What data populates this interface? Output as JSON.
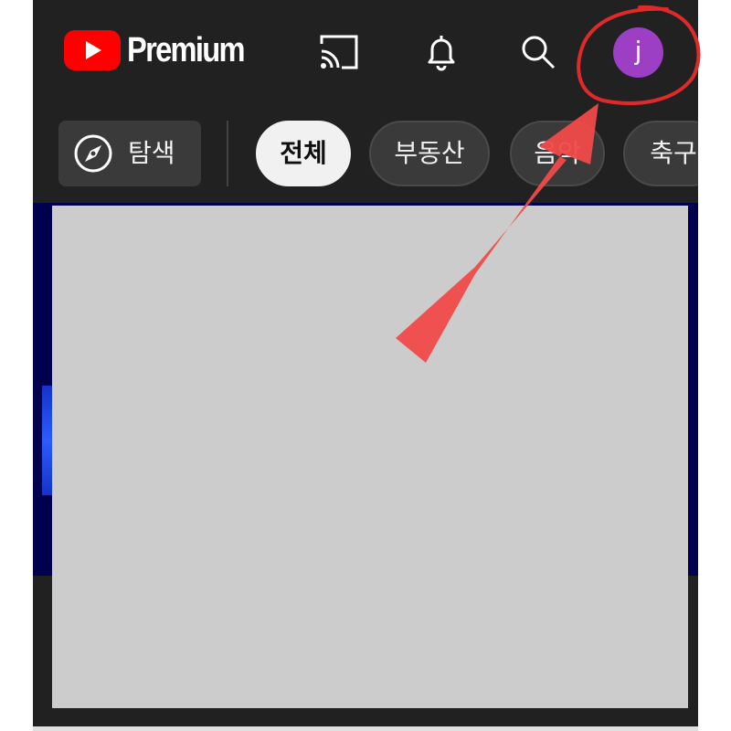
{
  "header": {
    "logo_text": "Premium",
    "avatar_initial": "j"
  },
  "icons": {
    "logo": "youtube-play-icon",
    "cast": "cast-icon",
    "notifications": "bell-icon",
    "search": "search-icon",
    "explore": "compass-icon"
  },
  "chips": {
    "explore_label": "탐색",
    "items": [
      "전체",
      "부동산",
      "음악",
      "축구"
    ],
    "selected": "전체"
  },
  "colors": {
    "background": "#212121",
    "brand_red": "#ff0000",
    "avatar": "#9c3fc5",
    "chip_selected": "#f1f1f1",
    "annotation_red": "#e02a2a",
    "arrow_red": "#f04a4a",
    "redaction": "#cccccc",
    "video_bg": "#00004e"
  }
}
